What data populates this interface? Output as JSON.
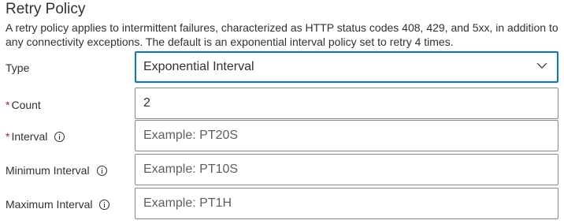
{
  "section": {
    "title": "Retry Policy",
    "description": "A retry policy applies to intermittent failures, characterized as HTTP status codes 408, 429, and 5xx, in addition to any connectivity exceptions. The default is an exponential interval policy set to retry 4 times."
  },
  "fields": {
    "type": {
      "label": "Type",
      "value": "Exponential Interval"
    },
    "count": {
      "required_marker": "*",
      "label": "Count",
      "value": "2"
    },
    "interval": {
      "required_marker": "*",
      "label": "Interval",
      "placeholder": "Example: PT20S"
    },
    "minimum_interval": {
      "label": "Minimum Interval",
      "placeholder": "Example: PT10S"
    },
    "maximum_interval": {
      "label": "Maximum Interval",
      "placeholder": "Example: PT1H"
    }
  },
  "colors": {
    "focus_border": "#0078d4",
    "required": "#a4262c",
    "border": "#8a8886"
  },
  "icons": {
    "info": "info-icon",
    "dropdown": "chevron-down-icon"
  }
}
